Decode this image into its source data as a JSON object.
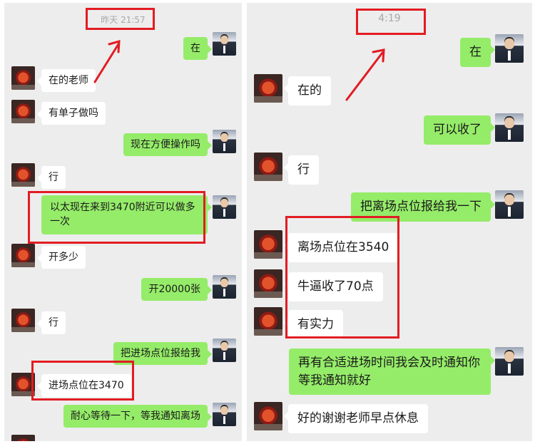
{
  "left": {
    "timestamp": "昨天 21:57",
    "messages": [
      {
        "side": "out",
        "text": "在"
      },
      {
        "side": "in",
        "text": "在的老师"
      },
      {
        "side": "in",
        "text": "有单子做吗"
      },
      {
        "side": "out",
        "text": "现在方便操作吗"
      },
      {
        "side": "in",
        "text": "行"
      },
      {
        "side": "out",
        "text": "以太现在来到3470附近可以做多一次"
      },
      {
        "side": "in",
        "text": "开多少"
      },
      {
        "side": "out",
        "text": "开20000张"
      },
      {
        "side": "in",
        "text": "行"
      },
      {
        "side": "out",
        "text": "把进场点位报给我"
      },
      {
        "side": "in",
        "text": "进场点位在3470"
      },
      {
        "side": "out",
        "text": "耐心等待一下，等我通知离场"
      }
    ]
  },
  "right": {
    "timestamp": "4:19",
    "messages": [
      {
        "side": "out",
        "text": "在"
      },
      {
        "side": "in",
        "text": "在的"
      },
      {
        "side": "out",
        "text": "可以收了"
      },
      {
        "side": "in",
        "text": "行"
      },
      {
        "side": "out",
        "text": "把离场点位报给我一下"
      },
      {
        "side": "in",
        "text": "离场点位在3540"
      },
      {
        "side": "in",
        "text": "牛逼收了70点"
      },
      {
        "side": "in",
        "text": "有实力"
      },
      {
        "side": "out",
        "text": "再有合适进场时间我会及时通知你等我通知就好"
      },
      {
        "side": "in",
        "text": "好的谢谢老师早点休息"
      }
    ]
  },
  "colors": {
    "chat_bg": "#ededed",
    "incoming_bubble": "#ffffff",
    "outgoing_bubble": "#95ec69",
    "annotation_red": "#e21c22"
  }
}
